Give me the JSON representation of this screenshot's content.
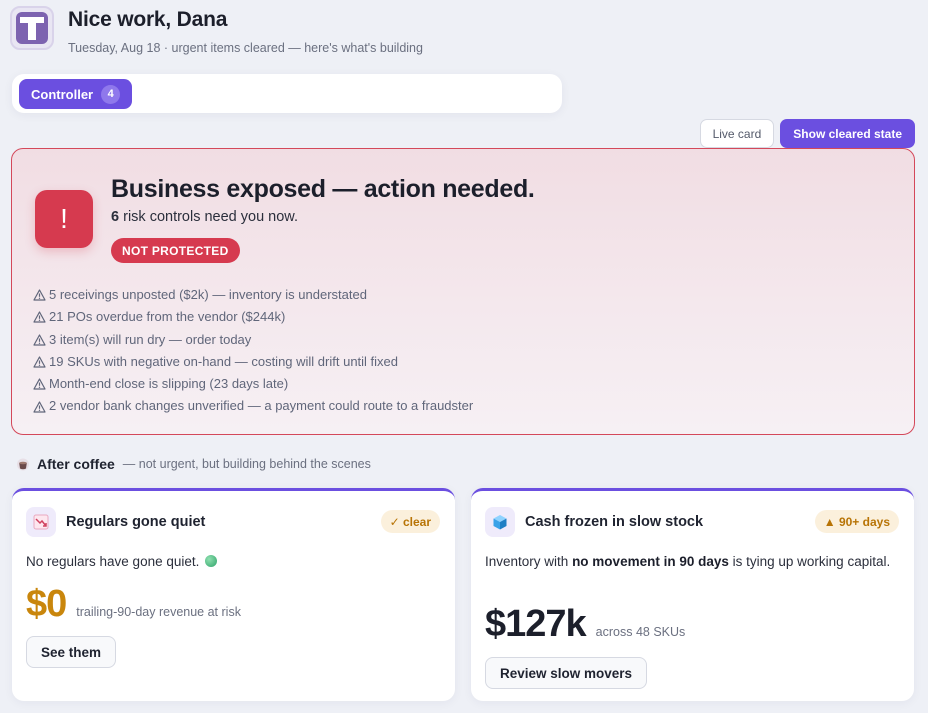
{
  "header": {
    "logo_letter": "T",
    "title": "Nice work, Dana",
    "subtitle": "Tuesday, Aug 18 · urgent items cleared — here's what's building"
  },
  "tabs": [
    {
      "label": "Controller",
      "count": "4",
      "active": true
    }
  ],
  "toggle": {
    "live_label": "Live card",
    "cleared_label": "Show cleared state"
  },
  "alert": {
    "icon": "!",
    "title": "Business exposed — action needed.",
    "count": "6",
    "subtitle_rest": "risk controls need you now.",
    "badge": "NOT PROTECTED",
    "items": [
      "5 receivings unposted ($2k) — inventory is understated",
      "21 POs overdue from the vendor ($244k)",
      "3 item(s) will run dry — order today",
      "19 SKUs with negative on-hand — costing will drift until fixed",
      "Month-end close is slipping (23 days late)",
      "2 vendor bank changes unverified — a payment could route to a fraudster"
    ]
  },
  "after_coffee": {
    "title": "After coffee",
    "note": "— not urgent, but building behind the scenes"
  },
  "cards": {
    "regulars": {
      "icon": "chart-down-icon",
      "title": "Regulars gone quiet",
      "pill": "✓ clear",
      "text": "No regulars have gone quiet.",
      "value": "$0",
      "caption": "trailing-90-day revenue at risk",
      "button": "See them"
    },
    "cash": {
      "icon": "cube-icon",
      "title": "Cash frozen in slow stock",
      "pill": "▲ 90+ days",
      "text_pre": "Inventory with",
      "text_bold": "no movement in 90 days",
      "text_post": "is tying up working capital.",
      "value": "$127k",
      "caption": "across 48 SKUs",
      "button": "Review slow movers"
    }
  },
  "colors": {
    "accent": "#6b4fe0",
    "danger": "#d63a4f",
    "amber": "#c9860c"
  }
}
